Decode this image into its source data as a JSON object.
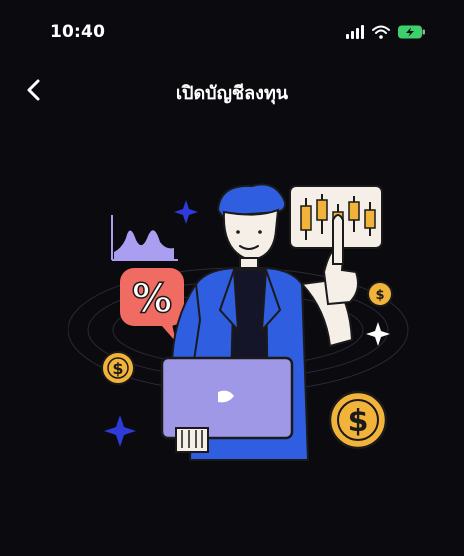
{
  "status": {
    "time": "10:40",
    "icons": [
      "signal-icon",
      "wifi-icon",
      "battery-charging-icon"
    ]
  },
  "nav": {
    "back_icon": "chevron-left-icon",
    "title": "เปิดบัญชีลงทุน"
  },
  "illustration": {
    "subject": "investor-with-laptop",
    "percent_symbol": "%",
    "currency_symbol": "$",
    "colors": {
      "background": "#0b0a0f",
      "jacket": "#2f5fe0",
      "laptop": "#9f98e6",
      "chart": "#a99ef0",
      "percent_bubble": "#f06b62",
      "coin": "#f1b33a",
      "skin": "#f6efe8"
    }
  }
}
